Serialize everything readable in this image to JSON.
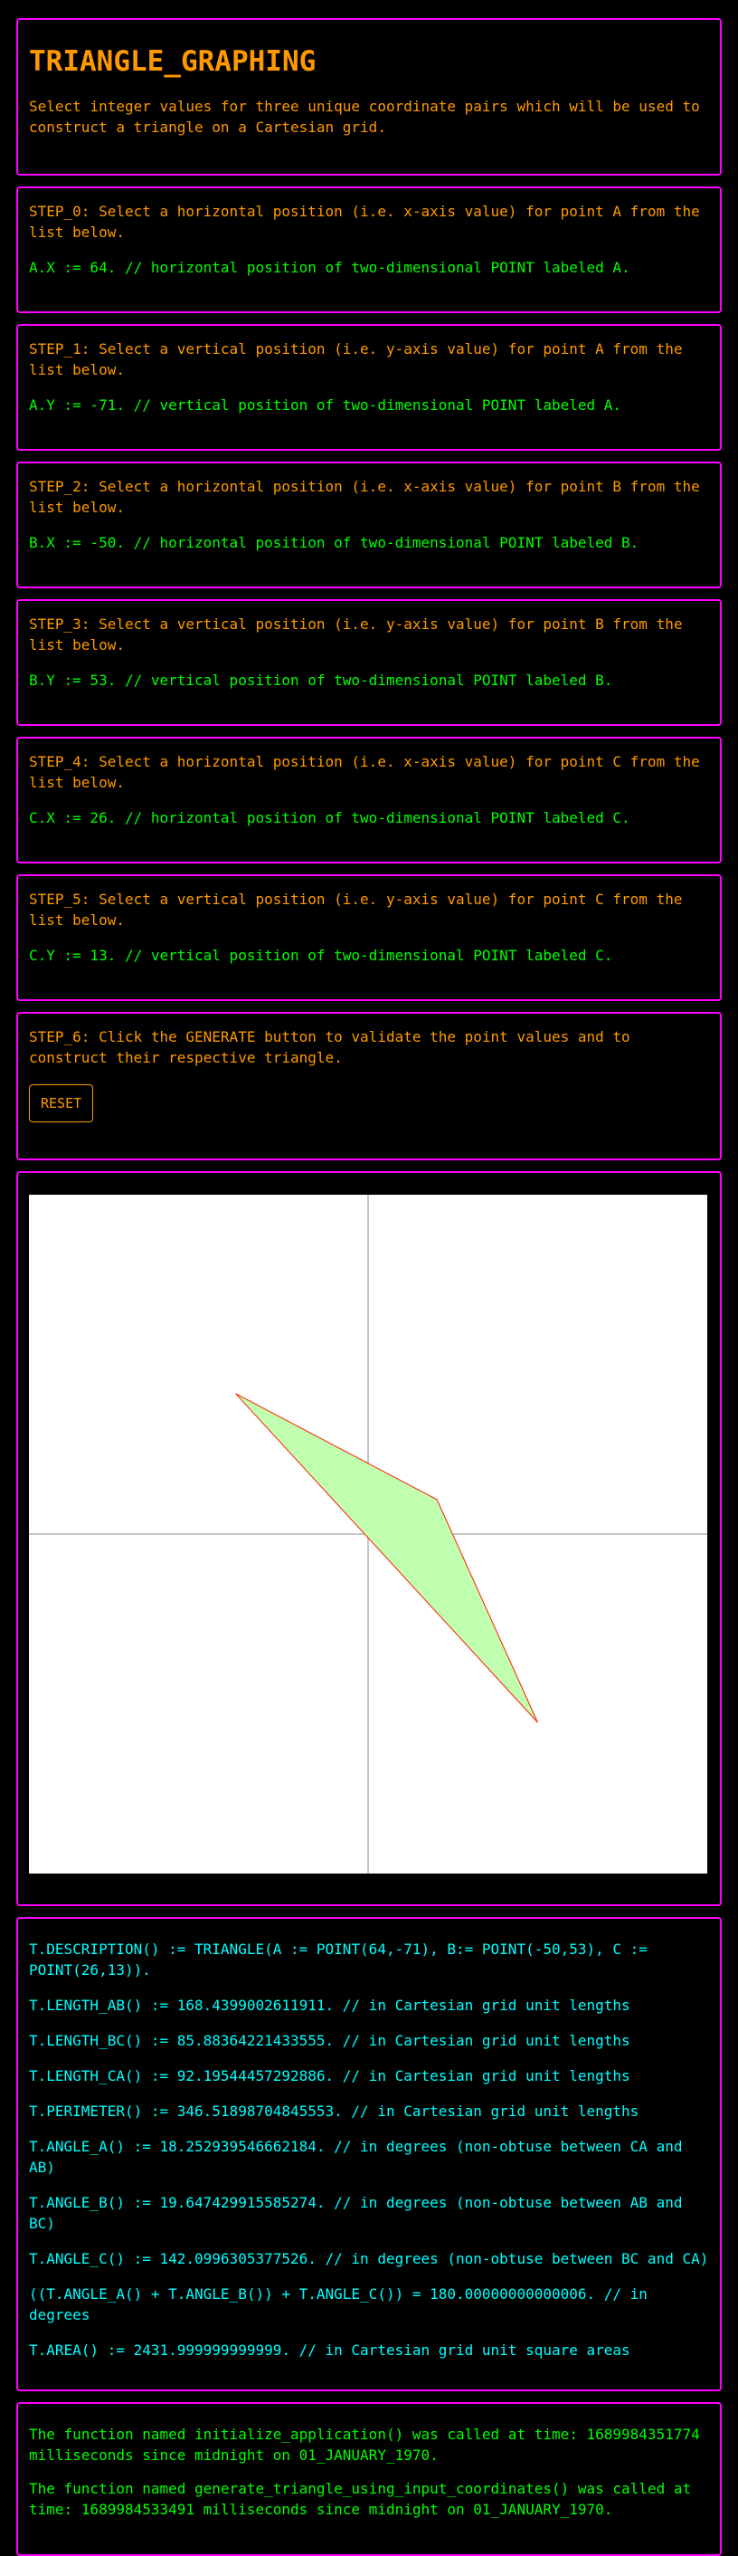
{
  "header": {
    "title": "TRIANGLE_GRAPHING",
    "description": "Select integer values for three unique coordinate pairs which will be used to construct a triangle on a Cartesian grid."
  },
  "steps": [
    {
      "instruction": "STEP_0: Select a horizontal position (i.e. x-axis value) for point A from the list below.",
      "value_text": "A.X := 64. // horizontal position of two-dimensional POINT labeled A."
    },
    {
      "instruction": "STEP_1: Select a vertical position (i.e. y-axis value) for point A from the list below.",
      "value_text": "A.Y := -71. // vertical position of two-dimensional POINT labeled A."
    },
    {
      "instruction": "STEP_2: Select a horizontal position (i.e. x-axis value) for point B from the list below.",
      "value_text": "B.X := -50. // horizontal position of two-dimensional POINT labeled B."
    },
    {
      "instruction": "STEP_3: Select a vertical position (i.e. y-axis value) for point B from the list below.",
      "value_text": "B.Y := 53. // vertical position of two-dimensional POINT labeled B."
    },
    {
      "instruction": "STEP_4: Select a horizontal position (i.e. x-axis value) for point C from the list below.",
      "value_text": "C.X := 26. // horizontal position of two-dimensional POINT labeled C."
    },
    {
      "instruction": "STEP_5: Select a vertical position (i.e. y-axis value) for point C from the list below.",
      "value_text": "C.Y := 13. // vertical position of two-dimensional POINT labeled C."
    }
  ],
  "step6": {
    "instruction": "STEP_6: Click the GENERATE button to validate the point values and to construct their respective triangle.",
    "reset_label": "RESET"
  },
  "graph": {
    "points": {
      "A": {
        "x": 64,
        "y": -71
      },
      "B": {
        "x": -50,
        "y": 53
      },
      "C": {
        "x": 26,
        "y": 13
      }
    },
    "fill_color": "#c0ffb0",
    "stroke_color": "#ff2000",
    "axis_color": "#888888",
    "background_color": "#ffffff"
  },
  "results": [
    "T.DESCRIPTION() := TRIANGLE(A := POINT(64,-71), B:= POINT(-50,53), C := POINT(26,13)).",
    "T.LENGTH_AB() := 168.4399002611911. // in Cartesian grid unit lengths",
    "T.LENGTH_BC() := 85.88364221433555. // in Cartesian grid unit lengths",
    "T.LENGTH_CA() := 92.19544457292886. // in Cartesian grid unit lengths",
    "T.PERIMETER() := 346.51898704845553. // in Cartesian grid unit lengths",
    "T.ANGLE_A() := 18.252939546662184. // in degrees (non-obtuse between CA and AB)",
    "T.ANGLE_B() := 19.647429915585274. // in degrees (non-obtuse between AB and BC)",
    "T.ANGLE_C() := 142.0996305377526. // in degrees (non-obtuse between BC and CA)",
    "((T.ANGLE_A() + T.ANGLE_B()) + T.ANGLE_C()) = 180.00000000000006. // in degrees",
    "T.AREA() := 2431.999999999999. // in Cartesian grid unit square areas"
  ],
  "log": [
    "The function named initialize_application() was called at time: 1689984351774 milliseconds since midnight on 01_JANUARY_1970.",
    "The function named generate_triangle_using_input_coordinates() was called at time: 1689984533491 milliseconds since midnight on 01_JANUARY_1970."
  ]
}
